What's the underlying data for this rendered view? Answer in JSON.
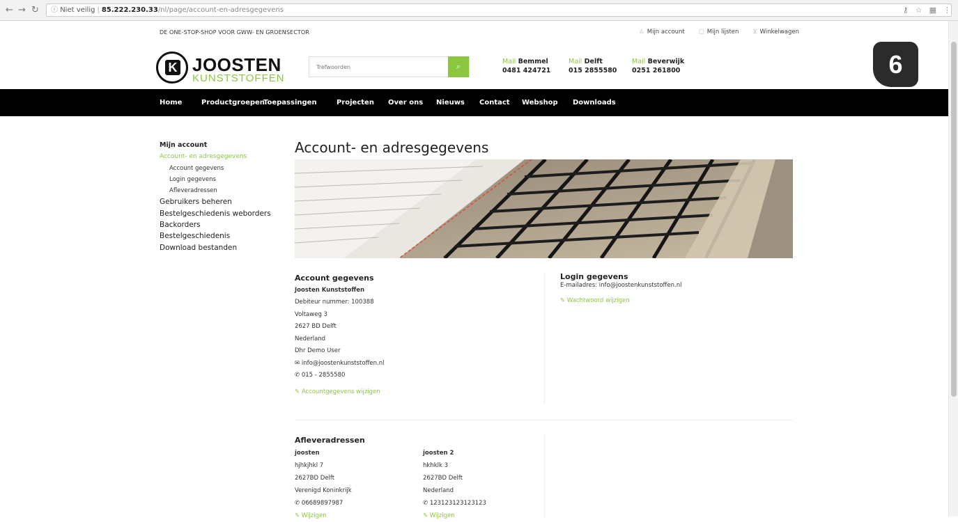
{
  "browser": {
    "security": "Niet veilig",
    "host": "85.222.230.33",
    "path": "/nl/page/account-en-adresgegevens"
  },
  "topbar": {
    "tagline": "DE ONE-STOP-SHOP VOOR GWW- EN GROENSECTOR",
    "links": [
      "Mijn account",
      "Mijn lijsten",
      "Winkelwagen"
    ]
  },
  "logo": {
    "line1": "JOOSTEN",
    "line2": "KUNSTSTOFFEN",
    "mark": "K"
  },
  "search": {
    "placeholder": "Trefwoorden"
  },
  "contacts": [
    {
      "mail": "Mail",
      "city": "Bemmel",
      "phone": "0481 424721"
    },
    {
      "mail": "Mail",
      "city": "Delft",
      "phone": "015 2855580"
    },
    {
      "mail": "Mail",
      "city": "Beverwijk",
      "phone": "0251 261800"
    }
  ],
  "badge": "6",
  "nav": [
    "Home",
    "Productgroepen",
    "Toepassingen",
    "Projecten",
    "Over ons",
    "Nieuws",
    "Contact",
    "Webshop",
    "Downloads"
  ],
  "sidebar": {
    "heading": "Mijn account",
    "active": "Account- en adresgegevens",
    "subs": [
      "Account gegevens",
      "Login gegevens",
      "Afleveradressen"
    ],
    "items": [
      "Gebruikers beheren",
      "Bestelgeschiedenis weborders",
      "Backorders",
      "Bestelgeschiedenis",
      "Download bestanden"
    ]
  },
  "page_title": "Account- en adresgegevens",
  "account": {
    "heading": "Account gegevens",
    "company": "Joosten Kunststoffen",
    "debtor": "Debiteur nummer: 100388",
    "street": "Voltaweg 3",
    "zip": "2627 BD Delft",
    "country": "Nederland",
    "contact": "Dhr Demo User",
    "email": "info@joostenkunststoffen.nl",
    "phone": "015 - 2855580",
    "edit_link": "Accountgegevens wijzigen"
  },
  "login": {
    "heading": "Login gegevens",
    "email": "E-mailadres: info@joostenkunststoffen.nl",
    "edit_link": "Wachtwoord wijzigen"
  },
  "addresses": {
    "heading": "Afleveradressen",
    "list": [
      {
        "name": "joosten",
        "street": "hjhkjhkl 7",
        "zip": "2627BD Delft",
        "country": "Verenigd Koninkrijk",
        "phone": "06689897987",
        "edit": "Wijzigen"
      },
      {
        "name": "joosten 2",
        "street": "hkhklk 3",
        "zip": "2627BD Delft",
        "country": "Nederland",
        "phone": "123123123123123",
        "edit": "Wijzigen"
      }
    ]
  }
}
